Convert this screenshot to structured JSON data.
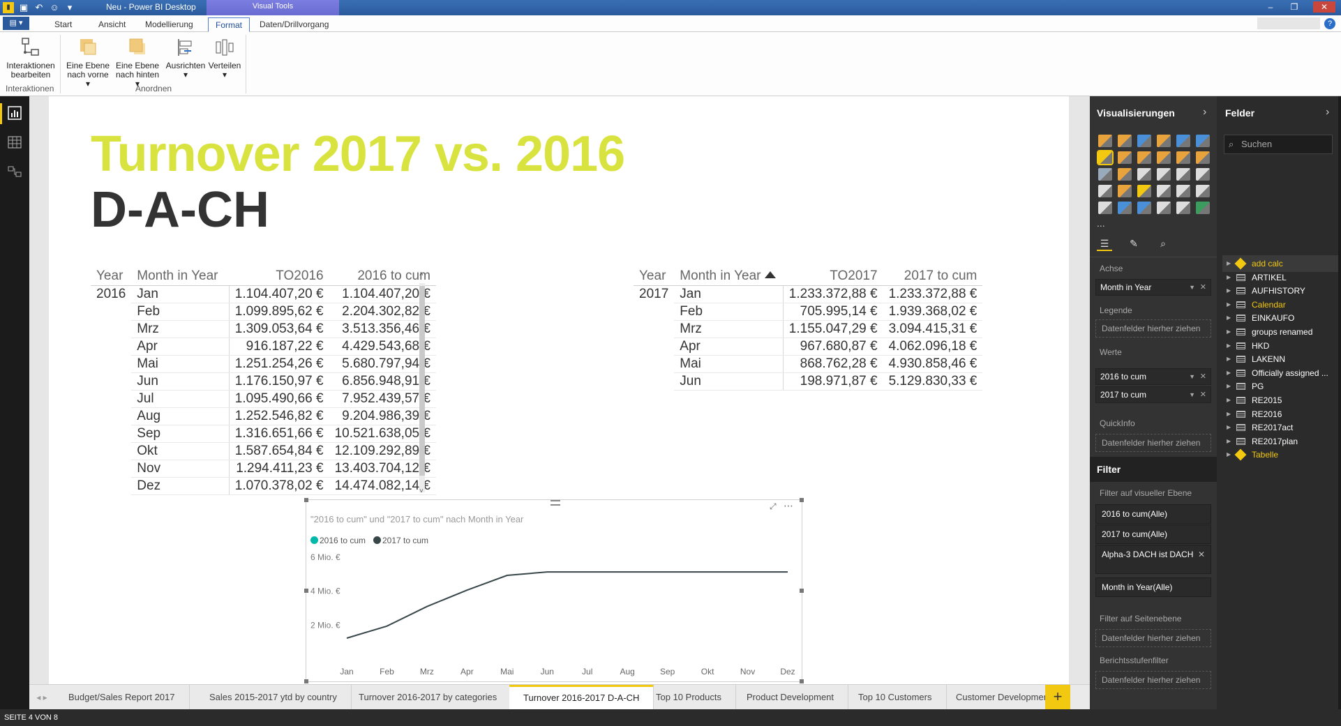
{
  "window": {
    "title": "Neu - Power BI Desktop",
    "visual_tools_label": "Visual Tools",
    "controls": [
      "–",
      "❐",
      "✕"
    ]
  },
  "ribbon": {
    "file_label": "▤ ▾",
    "tabs": [
      "Start",
      "Ansicht",
      "Modellierung",
      "Format",
      "Daten/Drillvorgang"
    ],
    "active_tab": "Format",
    "buttons": {
      "interactions": [
        "Interaktionen",
        "bearbeiten"
      ],
      "bring_forward": [
        "Eine Ebene",
        "nach vorne ▾"
      ],
      "send_backward": [
        "Eine Ebene",
        "nach hinten ▾"
      ],
      "align": [
        "Ausrichten",
        "▾"
      ],
      "distribute": [
        "Verteilen",
        "▾"
      ]
    },
    "groups": {
      "interactions": "Interaktionen",
      "arrange": "Anordnen"
    }
  },
  "report": {
    "title_line1": "Turnover 2017 vs. 2016",
    "title_line2": "D-A-CH",
    "title_color": "#d9e33f"
  },
  "table_2016": {
    "headers": [
      "Year",
      "Month in Year",
      "TO2016",
      "2016 to cum"
    ],
    "year": "2016",
    "rows": [
      [
        "Jan",
        "1.104.407,20 €",
        "1.104.407,20 €"
      ],
      [
        "Feb",
        "1.099.895,62 €",
        "2.204.302,82 €"
      ],
      [
        "Mrz",
        "1.309.053,64 €",
        "3.513.356,46 €"
      ],
      [
        "Apr",
        "916.187,22 €",
        "4.429.543,68 €"
      ],
      [
        "Mai",
        "1.251.254,26 €",
        "5.680.797,94 €"
      ],
      [
        "Jun",
        "1.176.150,97 €",
        "6.856.948,91 €"
      ],
      [
        "Jul",
        "1.095.490,66 €",
        "7.952.439,57 €"
      ],
      [
        "Aug",
        "1.252.546,82 €",
        "9.204.986,39 €"
      ],
      [
        "Sep",
        "1.316.651,66 €",
        "10.521.638,05 €"
      ],
      [
        "Okt",
        "1.587.654,84 €",
        "12.109.292,89 €"
      ],
      [
        "Nov",
        "1.294.411,23 €",
        "13.403.704,12 €"
      ],
      [
        "Dez",
        "1.070.378,02 €",
        "14.474.082,14 €"
      ]
    ]
  },
  "table_2017": {
    "headers": [
      "Year",
      "Month in Year",
      "TO2017",
      "2017 to cum"
    ],
    "year": "2017",
    "rows": [
      [
        "Jan",
        "1.233.372,88 €",
        "1.233.372,88 €"
      ],
      [
        "Feb",
        "705.995,14 €",
        "1.939.368,02 €"
      ],
      [
        "Mrz",
        "1.155.047,29 €",
        "3.094.415,31 €"
      ],
      [
        "Apr",
        "967.680,87 €",
        "4.062.096,18 €"
      ],
      [
        "Mai",
        "868.762,28 €",
        "4.930.858,46 €"
      ],
      [
        "Jun",
        "198.971,87 €",
        "5.129.830,33 €"
      ]
    ]
  },
  "chart_data": {
    "type": "line",
    "title": "\"2016 to cum\" und \"2017 to cum\" nach Month in Year",
    "categories": [
      "Jan",
      "Feb",
      "Mrz",
      "Apr",
      "Mai",
      "Jun",
      "Jul",
      "Aug",
      "Sep",
      "Okt",
      "Nov",
      "Dez"
    ],
    "series": [
      {
        "name": "2016 to cum",
        "color": "#01b8aa",
        "values": []
      },
      {
        "name": "2017 to cum",
        "color": "#374649",
        "values": [
          1233372.88,
          1939368.02,
          3094415.31,
          4062096.18,
          4930858.46,
          5129830.33,
          5129830.33,
          5129830.33,
          5129830.33,
          5129830.33,
          5129830.33,
          5129830.33
        ]
      }
    ],
    "ylim": [
      0,
      6000000
    ],
    "yticks": [
      {
        "value": 2000000,
        "label": "2 Mio. €"
      },
      {
        "value": 4000000,
        "label": "4 Mio. €"
      },
      {
        "value": 6000000,
        "label": "6 Mio. €"
      }
    ],
    "grid": false,
    "legend_position": "top-left"
  },
  "page_tabs": {
    "tabs": [
      "Budget/Sales Report 2017",
      "Sales 2015-2017 ytd by country",
      "Turnover 2016-2017 by categories",
      "Turnover 2016-2017 D-A-CH",
      "Top 10 Products",
      "Product Development",
      "Top 10 Customers",
      "Customer Development"
    ],
    "active": "Turnover 2016-2017 D-A-CH",
    "add_label": "+",
    "nav_label": "◂ ▸"
  },
  "status": {
    "page_indicator": "SEITE 4 VON 8"
  },
  "visualizations": {
    "header": "Visualisierungen",
    "sections": {
      "axis": "Achse",
      "legend": "Legende",
      "values": "Werte",
      "tooltip": "QuickInfo"
    },
    "axis_field": "Month in Year",
    "value_fields": [
      "2016 to cum",
      "2017 to cum"
    ],
    "drop_placeholder": "Datenfelder hierher ziehen",
    "more_label": "..."
  },
  "filters": {
    "header": "Filter",
    "visual_level": "Filter auf visueller Ebene",
    "cards": [
      "2016 to cum(Alle)",
      "2017 to cum(Alle)",
      "Alpha-3 DACH ist DACH",
      "Month in Year(Alle)"
    ],
    "page_level": "Filter auf Seitenebene",
    "report_level": "Berichtsstufenfilter",
    "drop_placeholder": "Datenfelder hierher ziehen"
  },
  "fields": {
    "header": "Felder",
    "search_placeholder": "Suchen",
    "items": [
      {
        "name": "add calc",
        "kind": "calc"
      },
      {
        "name": "ARTIKEL",
        "kind": "table"
      },
      {
        "name": "AUFHISTORY",
        "kind": "table"
      },
      {
        "name": "Calendar",
        "kind": "table-highlight"
      },
      {
        "name": "EINKAUFO",
        "kind": "table"
      },
      {
        "name": "groups renamed",
        "kind": "table"
      },
      {
        "name": "HKD",
        "kind": "table"
      },
      {
        "name": "LAKENN",
        "kind": "table"
      },
      {
        "name": "Officially assigned ...",
        "kind": "table"
      },
      {
        "name": "PG",
        "kind": "table"
      },
      {
        "name": "RE2015",
        "kind": "table"
      },
      {
        "name": "RE2016",
        "kind": "table"
      },
      {
        "name": "RE2017act",
        "kind": "table"
      },
      {
        "name": "RE2017plan",
        "kind": "table"
      },
      {
        "name": "Tabelle",
        "kind": "calc"
      }
    ]
  }
}
